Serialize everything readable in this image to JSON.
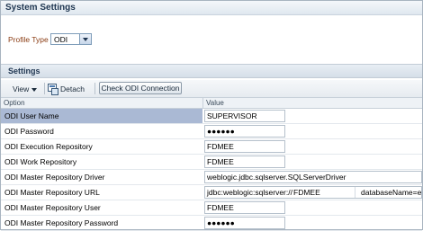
{
  "window": {
    "title": "System Settings"
  },
  "profile": {
    "label": "Profile Type",
    "value": "ODI"
  },
  "section": {
    "title": "Settings"
  },
  "toolbar": {
    "view_label": "View",
    "detach_label": "Detach",
    "check_button": "Check ODI Connection"
  },
  "table": {
    "columns": [
      "Option",
      "Value"
    ],
    "rows": [
      {
        "option": "ODI User Name",
        "value": "SUPERVISOR",
        "selected": true
      },
      {
        "option": "ODI Password",
        "value": "●●●●●●",
        "masked": true
      },
      {
        "option": "ODI Execution Repository",
        "value": "FDMEE"
      },
      {
        "option": "ODI Work Repository",
        "value": "FDMEE"
      },
      {
        "option": "ODI Master Repository Driver",
        "value": "weblogic.jdbc.sqlserver.SQLServerDriver"
      },
      {
        "option": "ODI Master Repository URL",
        "value_parts": [
          "jdbc:weblogic:sqlserver://",
          "FDMEE",
          "databaseName=epr"
        ]
      },
      {
        "option": "ODI Master Repository User",
        "value": "FDMEE"
      },
      {
        "option": "ODI Master Repository Password",
        "value": "●●●●●●",
        "masked": true
      }
    ]
  },
  "colors": {
    "selected_row": "#aab9d4",
    "title_text": "#1e3550",
    "label_text": "#8a3b12"
  }
}
